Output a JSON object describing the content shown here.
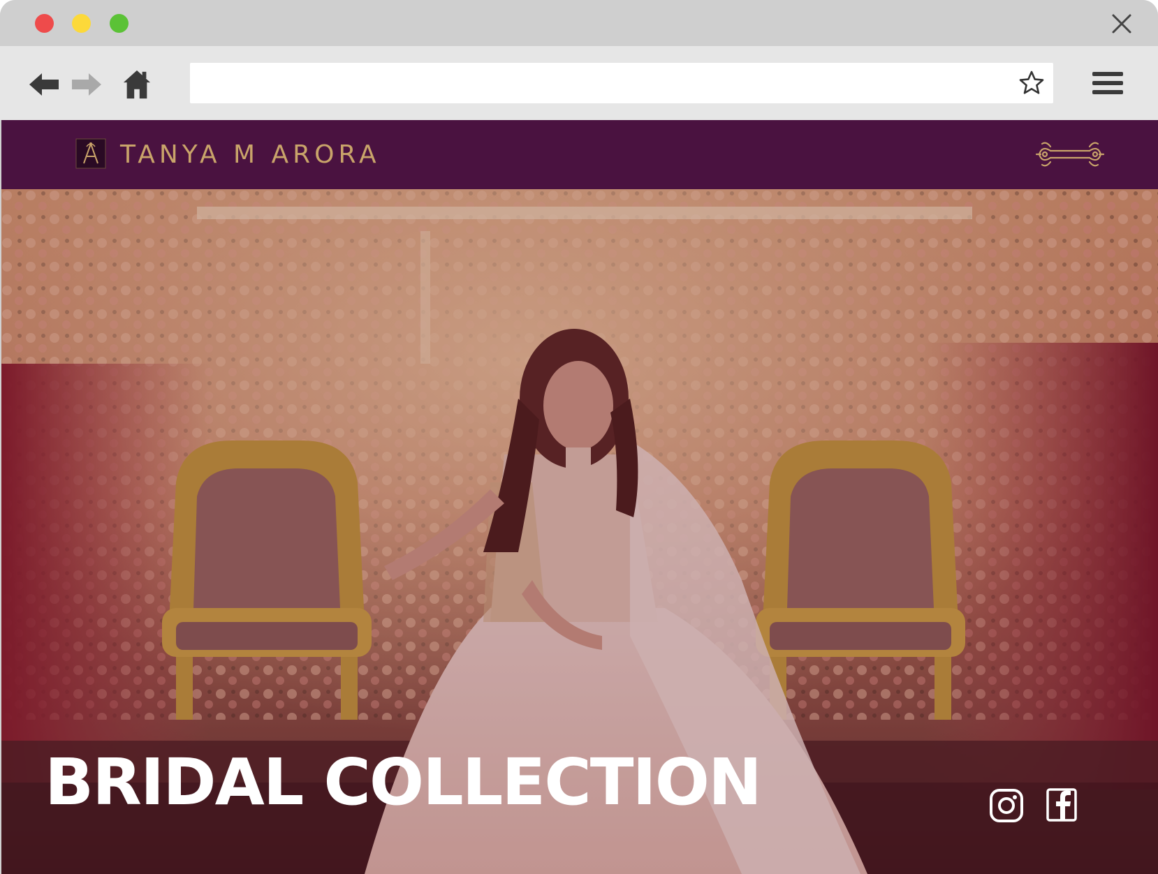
{
  "browser": {
    "url": "",
    "icons": {
      "back": "arrow-left-icon",
      "forward": "arrow-right-icon",
      "home": "home-icon",
      "bookmark": "star-icon",
      "menu": "hamburger-menu-icon",
      "close": "close-icon"
    }
  },
  "site": {
    "brand": "TANYA M ARORA",
    "hero_title": "BRIDAL COLLECTION",
    "colors": {
      "header_bg": "#4a1240",
      "brand_gold": "#c9a46a",
      "hero_text": "#ffffff"
    },
    "social": [
      "instagram-icon",
      "facebook-icon"
    ]
  }
}
